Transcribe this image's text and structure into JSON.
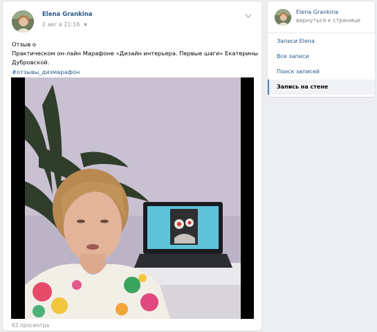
{
  "post": {
    "author": "Elena Grankina",
    "date": "2 авг в 21:16",
    "text_lines": [
      "Отзыв о",
      "Практическом он-лайн Марафоне «Дизайн интерьера. Первые шаги» Екатерины",
      "Дубровской."
    ],
    "hashtag": "#отзывы_дизмарафон",
    "views": "63 просмотра"
  },
  "sidebar": {
    "name": "Elena Grankina",
    "back_link": "вернуться к странице",
    "menu": [
      {
        "label": "Записи Elena"
      },
      {
        "label": "Все записи"
      },
      {
        "label": "Поиск записей"
      },
      {
        "label": "Запись на стене"
      }
    ]
  },
  "colors": {
    "link": "#2a5885",
    "meta": "#939393",
    "page_bg": "#edeef0",
    "active_menu_bg": "#f0f2f5",
    "active_marker": "#5181b8"
  },
  "icons": [
    "avatar-photo",
    "eye-icon",
    "chevron-down-icon",
    "video-thumbnail"
  ]
}
